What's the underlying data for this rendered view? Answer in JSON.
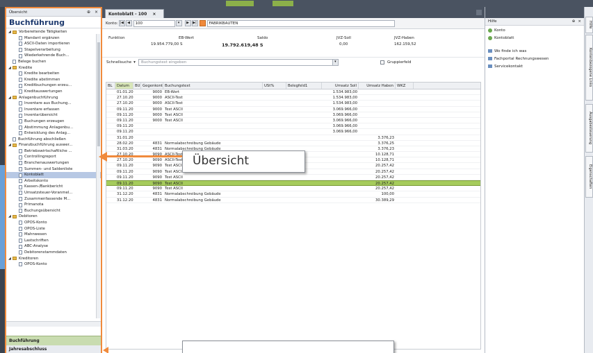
{
  "sidebar": {
    "header_title": "Übersicht",
    "pin_icon": "pin-icon",
    "close_icon": "close-icon",
    "title": "Buchführung",
    "items": [
      {
        "label": "Vorbereitende Tätigkeiten",
        "level": 0,
        "type": "folder",
        "expanded": true
      },
      {
        "label": "Mandant ergänzen",
        "level": 1,
        "type": "doc"
      },
      {
        "label": "ASCII-Daten importieren",
        "level": 1,
        "type": "doc"
      },
      {
        "label": "Stapelverarbeitung",
        "level": 1,
        "type": "doc"
      },
      {
        "label": "Wiederkehrende Buch...",
        "level": 1,
        "type": "doc"
      },
      {
        "label": "Belege buchen",
        "level": 0,
        "type": "doc"
      },
      {
        "label": "Kredite",
        "level": 0,
        "type": "folder",
        "expanded": true
      },
      {
        "label": "Kredite bearbeiten",
        "level": 1,
        "type": "doc"
      },
      {
        "label": "Kredite abstimmen",
        "level": 1,
        "type": "doc"
      },
      {
        "label": "Kreditbuchungen erzeu...",
        "level": 1,
        "type": "doc"
      },
      {
        "label": "Kreditauswertungen",
        "level": 1,
        "type": "doc"
      },
      {
        "label": "Anlagenbuchführung",
        "level": 0,
        "type": "folder",
        "expanded": true
      },
      {
        "label": "Inventare aus Buchung...",
        "level": 1,
        "type": "doc"
      },
      {
        "label": "Inventare erfassen",
        "level": 1,
        "type": "doc"
      },
      {
        "label": "Inventarübersicht",
        "level": 1,
        "type": "doc"
      },
      {
        "label": "Buchungen erzeugen",
        "level": 1,
        "type": "doc"
      },
      {
        "label": "Abstimmung Anlagenbu...",
        "level": 1,
        "type": "doc"
      },
      {
        "label": "Entwicklung des Anlag...",
        "level": 1,
        "type": "doc"
      },
      {
        "label": "Buchführung abschließen",
        "level": 0,
        "type": "doc"
      },
      {
        "label": "Finanzbuchführung auswer...",
        "level": 0,
        "type": "folder",
        "expanded": true
      },
      {
        "label": "Betriebswirtschaftliche ...",
        "level": 1,
        "type": "doc"
      },
      {
        "label": "Controllingreport",
        "level": 1,
        "type": "doc"
      },
      {
        "label": "Branchenauswertungen",
        "level": 1,
        "type": "doc"
      },
      {
        "label": "Summen- und Saldenliste",
        "level": 1,
        "type": "doc"
      },
      {
        "label": "Kontoblatt",
        "level": 1,
        "type": "doc",
        "selected": true
      },
      {
        "label": "Arbeitskonto",
        "level": 1,
        "type": "doc"
      },
      {
        "label": "Kassen-/Bankbericht",
        "level": 1,
        "type": "doc"
      },
      {
        "label": "Umsatzsteuer-Voranmel...",
        "level": 1,
        "type": "doc"
      },
      {
        "label": "Zusammenfassende M...",
        "level": 1,
        "type": "doc"
      },
      {
        "label": "Primanota",
        "level": 1,
        "type": "doc"
      },
      {
        "label": "Buchungsübersicht",
        "level": 1,
        "type": "doc"
      },
      {
        "label": "Debitoren",
        "level": 0,
        "type": "folder",
        "expanded": true
      },
      {
        "label": "OPOS-Konto",
        "level": 1,
        "type": "doc"
      },
      {
        "label": "OPOS-Liste",
        "level": 1,
        "type": "doc"
      },
      {
        "label": "Mahnwesen",
        "level": 1,
        "type": "doc"
      },
      {
        "label": "Lastschriften",
        "level": 1,
        "type": "doc"
      },
      {
        "label": "ABC-Analyse",
        "level": 1,
        "type": "doc"
      },
      {
        "label": "Debitorenstammdaten",
        "level": 1,
        "type": "doc"
      },
      {
        "label": "Kreditoren",
        "level": 0,
        "type": "folder",
        "expanded": true
      },
      {
        "label": "OPOS-Konto",
        "level": 1,
        "type": "doc"
      }
    ],
    "bottom_nav_1": "Buchführung",
    "bottom_nav_2": "Jahresabschluss"
  },
  "main": {
    "tab_title": "Kontoblatt - 100",
    "tab_close": "×",
    "toolbar": {
      "konto_label": "Konto:",
      "konto_value": "100",
      "konto_name": "FABRIKBAUTEN"
    },
    "summary": {
      "funktion_label": "Funktion",
      "eb_label": "EB-Wert",
      "eb_value": "19.954.779,00 S",
      "saldo_label": "Saldo",
      "saldo_value": "19.792.619,48 S",
      "jvz_soll_label": "JVZ-Soll",
      "jvz_soll_value": "0,00",
      "jvz_haben_label": "JVZ-Haben",
      "jvz_haben_value": "162.159,52"
    },
    "search": {
      "label": "Schnellsuche",
      "placeholder": "Buchungstext eingeben",
      "grouped_label": "Gruppierfeld"
    },
    "columns": [
      "BL",
      "Datum",
      "BU",
      "Gegenkonto",
      "Buchungstext",
      "USt%",
      "Belegfeld1",
      "Umsatz Soll",
      "Umsatz Haben",
      "WKZ"
    ],
    "rows": [
      {
        "datum": "01.01.2010",
        "gk": "9000",
        "text": "EB-Wert",
        "soll": "1.534.983,00",
        "haben": ""
      },
      {
        "datum": "27.10.2010",
        "gk": "9000",
        "text": "ASCII-Test",
        "soll": "1.534.983,00",
        "haben": ""
      },
      {
        "datum": "27.10.2010",
        "gk": "9000",
        "text": "ASCII-Test",
        "soll": "1.534.983,00",
        "haben": ""
      },
      {
        "datum": "09.11.2010",
        "gk": "9000",
        "text": "Test ASCII",
        "soll": "3.069.966,00",
        "haben": ""
      },
      {
        "datum": "09.11.2010",
        "gk": "9000",
        "text": "Test ASCII",
        "soll": "3.069.966,00",
        "haben": ""
      },
      {
        "datum": "09.11.2010",
        "gk": "9000",
        "text": "Test ASCII",
        "soll": "3.069.966,00",
        "haben": ""
      },
      {
        "datum": "09.11.2010",
        "gk": "",
        "text": "",
        "soll": "3.069.966,00",
        "haben": ""
      },
      {
        "datum": "09.11.2010",
        "gk": "",
        "text": "",
        "soll": "3.069.966,00",
        "haben": ""
      },
      {
        "datum": "31.01.2010",
        "gk": "",
        "text": "",
        "soll": "",
        "haben": "3.376,23"
      },
      {
        "datum": "28.02.2010",
        "gk": "4831",
        "text": "Normalabschreibung Gebäude",
        "soll": "",
        "haben": "3.376,25"
      },
      {
        "datum": "31.03.2010",
        "gk": "4831",
        "text": "Normalabschreibung Gebäude",
        "soll": "",
        "haben": "3.376,23"
      },
      {
        "datum": "27.10.2010",
        "gk": "9090",
        "text": "ASCII-Test",
        "soll": "",
        "haben": "10.128,71"
      },
      {
        "datum": "27.10.2010",
        "gk": "9090",
        "text": "ASCII-Test",
        "soll": "",
        "haben": "10.128,71"
      },
      {
        "datum": "09.11.2010",
        "gk": "9090",
        "text": "Test ASCII",
        "soll": "",
        "haben": "20.257,42"
      },
      {
        "datum": "09.11.2010",
        "gk": "9090",
        "text": "Test ASCII",
        "soll": "",
        "haben": "20.257,42"
      },
      {
        "datum": "09.11.2010",
        "gk": "9090",
        "text": "Test ASCII",
        "soll": "",
        "haben": "20.257,42"
      },
      {
        "datum": "09.11.2010",
        "gk": "9090",
        "text": "Test ASCII",
        "soll": "",
        "haben": "20.257,42",
        "selected": true
      },
      {
        "datum": "09.11.2010",
        "gk": "9090",
        "text": "Test ASCII",
        "soll": "",
        "haben": "20.257,42"
      },
      {
        "datum": "31.12.2010",
        "gk": "4831",
        "text": "Normalabschreibung Gebäude",
        "soll": "",
        "haben": "100,00"
      },
      {
        "datum": "31.12.2010",
        "gk": "4831",
        "text": "Normalabschreibung Gebäude",
        "soll": "",
        "haben": "30.389,29"
      }
    ]
  },
  "callout": {
    "text": "Übersicht",
    "arrow_color": "#f08a3c"
  },
  "right_pane": {
    "title": "Hilfe",
    "items": [
      {
        "label": "Konto",
        "icon": "green-circle-icon"
      },
      {
        "label": "Kontoblatt",
        "icon": "green-circle-icon"
      },
      {
        "label": "Wo finde ich was",
        "icon": "pencil-icon"
      },
      {
        "label": "Fachportal Rechnungswesen",
        "icon": "portal-icon"
      },
      {
        "label": "Servicekontakt",
        "icon": "service-icon"
      }
    ],
    "side_tabs": [
      "Hilfe",
      "Kontenbezogene Links",
      "Ausgabesteuerung",
      "Eigenschaften"
    ]
  },
  "colors": {
    "accent_orange": "#f08a3c",
    "selection_green": "#a6cc5c",
    "title_blue": "#1e3a6e"
  }
}
